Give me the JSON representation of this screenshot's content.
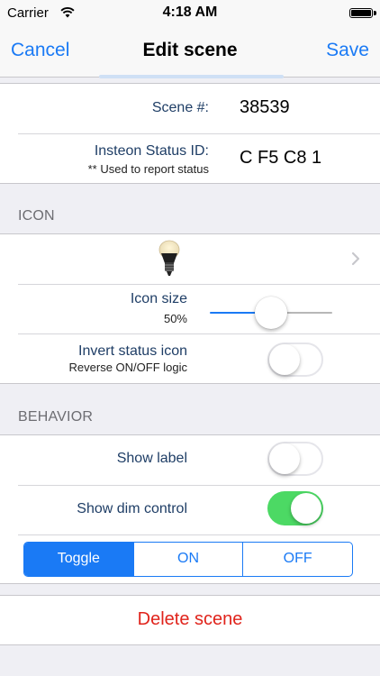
{
  "status_bar": {
    "carrier": "Carrier",
    "time": "4:18 AM"
  },
  "nav": {
    "left": "Cancel",
    "title": "Edit scene",
    "right": "Save"
  },
  "scene_info": {
    "scene_number_label": "Scene #:",
    "scene_number_value": "38539",
    "status_id_label": "Insteon Status ID:",
    "status_id_sublabel": "** Used to report status",
    "status_id_value": "C F5 C8 1"
  },
  "icon_section": {
    "header": "ICON",
    "selected_icon": "light-bulb-icon",
    "icon_size_label": "Icon size",
    "icon_size_value": "50%",
    "icon_size_fraction": 0.5,
    "invert_label": "Invert status icon",
    "invert_sublabel": "Reverse ON/OFF logic",
    "invert_on": false
  },
  "behavior_section": {
    "header": "BEHAVIOR",
    "show_label": "Show label",
    "show_label_on": false,
    "show_dim_control": "Show dim control",
    "show_dim_control_on": true,
    "segments": [
      "Toggle",
      "ON",
      "OFF"
    ],
    "selected_segment": "Toggle"
  },
  "delete_label": "Delete scene",
  "colors": {
    "accent": "#1a7af5",
    "switch_on": "#4cd964",
    "destructive": "#e0231b"
  }
}
